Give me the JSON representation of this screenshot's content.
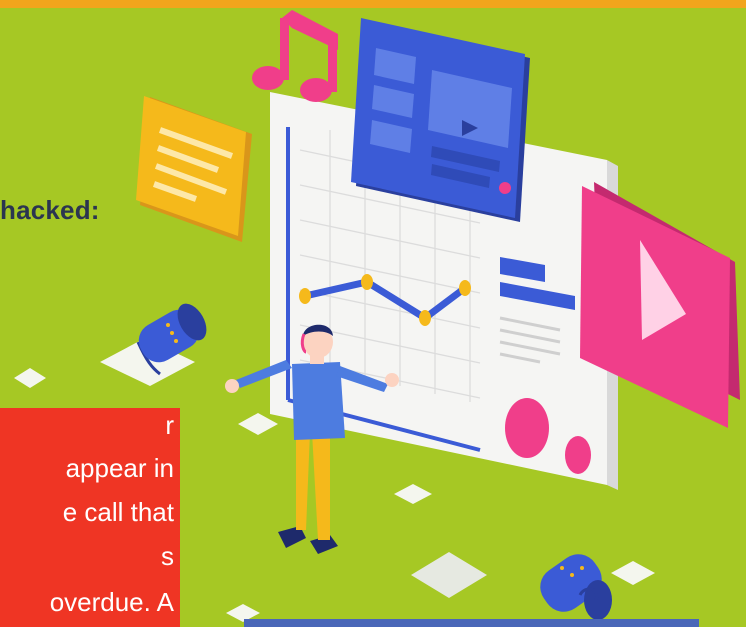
{
  "banner": {
    "partial_heading": "hacked:",
    "red_box_lines": [
      "r",
      "appear in",
      "e call that",
      "s",
      "overdue. A"
    ]
  },
  "colors": {
    "background": "#a6c824",
    "top_bar": "#f2a51c",
    "red_box": "#ef3524",
    "heading_text": "#2b3550",
    "bottom_bar": "#4a67b8",
    "pink": "#f03e8a",
    "blue_panel": "#3b5bd6"
  },
  "icons": [
    "music-note-icon",
    "message-card-icon",
    "video-window-icon",
    "play-card-icon",
    "speaker-icon",
    "line-chart-icon"
  ]
}
